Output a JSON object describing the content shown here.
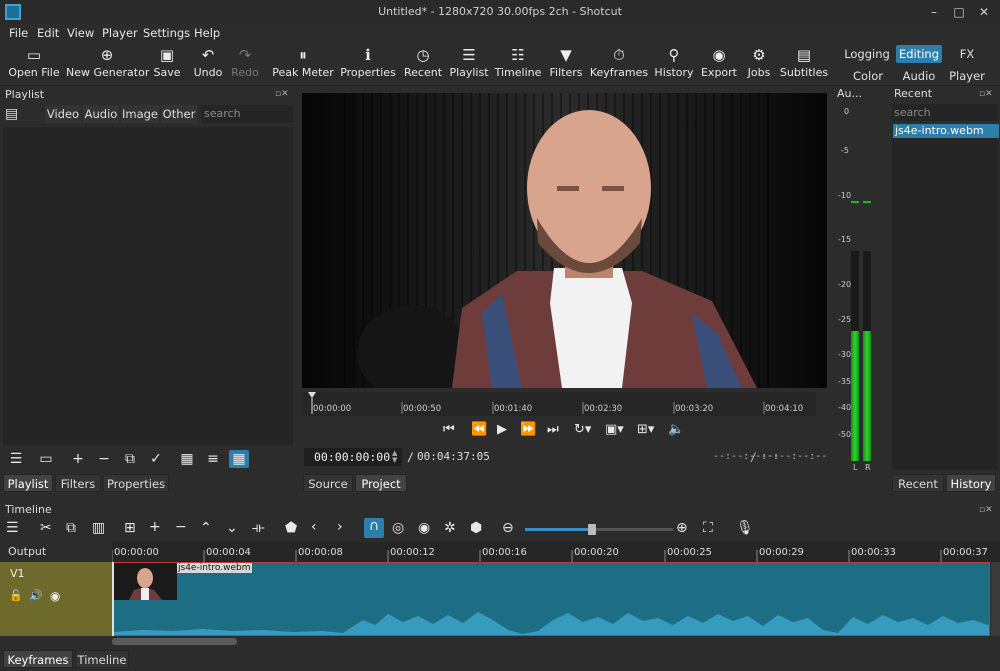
{
  "window": {
    "title": "Untitled* - 1280x720 30.00fps 2ch - Shotcut"
  },
  "menu": [
    "File",
    "Edit",
    "View",
    "Player",
    "Settings",
    "Help"
  ],
  "toolbar": {
    "items": [
      {
        "label": "Open File",
        "icon": "folder-icon",
        "glyph": "▭"
      },
      {
        "label": "New Generator",
        "icon": "generator-icon",
        "glyph": "⊕"
      },
      {
        "label": "Save",
        "icon": "save-icon",
        "glyph": "▣"
      },
      {
        "label": "Undo",
        "icon": "undo-icon",
        "glyph": "↶"
      },
      {
        "label": "Redo",
        "icon": "redo-icon",
        "glyph": "↷"
      },
      {
        "label": "Peak Meter",
        "icon": "peak-meter-icon",
        "glyph": "⏸"
      },
      {
        "label": "Properties",
        "icon": "properties-icon",
        "glyph": "ℹ"
      },
      {
        "label": "Recent",
        "icon": "clock-icon",
        "glyph": "◷"
      },
      {
        "label": "Playlist",
        "icon": "playlist-icon",
        "glyph": "☰"
      },
      {
        "label": "Timeline",
        "icon": "timeline-icon",
        "glyph": "☷"
      },
      {
        "label": "Filters",
        "icon": "filter-icon",
        "glyph": "▼"
      },
      {
        "label": "Keyframes",
        "icon": "stopwatch-icon",
        "glyph": "⏱"
      },
      {
        "label": "History",
        "icon": "history-icon",
        "glyph": "⚲"
      },
      {
        "label": "Export",
        "icon": "export-icon",
        "glyph": "◉"
      },
      {
        "label": "Jobs",
        "icon": "gear-icon",
        "glyph": "⚙"
      },
      {
        "label": "Subtitles",
        "icon": "subtitles-icon",
        "glyph": "▤"
      }
    ],
    "layouts_row1": [
      "Logging",
      "Editing",
      "FX"
    ],
    "layouts_row2": [
      "Color",
      "Audio",
      "Player"
    ]
  },
  "playlist": {
    "title": "Playlist",
    "filters": [
      "Video",
      "Audio",
      "Image",
      "Other"
    ],
    "search_placeholder": "search",
    "tabs": [
      "Playlist",
      "Filters",
      "Properties"
    ]
  },
  "player": {
    "ruler_ticks": [
      "00:00:00",
      "00:00:50",
      "00:01:40",
      "00:02:30",
      "00:03:20",
      "00:04:10"
    ],
    "current_time": "00:00:00:00",
    "separator": "/",
    "duration": "00:04:37:05",
    "in_point": "--:--:--:--",
    "out_point": "--:--:--:--",
    "tabs": [
      "Source",
      "Project"
    ]
  },
  "audio_meter": {
    "title": "Au...",
    "scale": [
      "0",
      "-5",
      "-10",
      "-15",
      "-20",
      "-25",
      "-30",
      "-35",
      "-40",
      "-50"
    ],
    "channels": [
      "L",
      "R"
    ],
    "level_left": 0.62,
    "level_right": 0.62,
    "color": "#1fb81f"
  },
  "recent": {
    "title": "Recent",
    "search_placeholder": "search",
    "items": [
      "js4e-intro.webm"
    ],
    "tabs": [
      "Recent",
      "History"
    ]
  },
  "timeline": {
    "title": "Timeline",
    "output_label": "Output",
    "track_name": "V1",
    "ticks": [
      "00:00:00",
      "00:00:04",
      "00:00:08",
      "00:00:12",
      "00:00:16",
      "00:00:20",
      "00:00:25",
      "00:00:29",
      "00:00:33",
      "00:00:37"
    ],
    "clip_name": "js4e-intro.webm",
    "zoom_level": 0.45,
    "tabs": [
      "Keyframes",
      "Timeline"
    ]
  },
  "colors": {
    "accent": "#2d7fab",
    "track_header": "#6d6a2b",
    "clip": "#1d6e85",
    "waveform": "#3aa0c4"
  }
}
